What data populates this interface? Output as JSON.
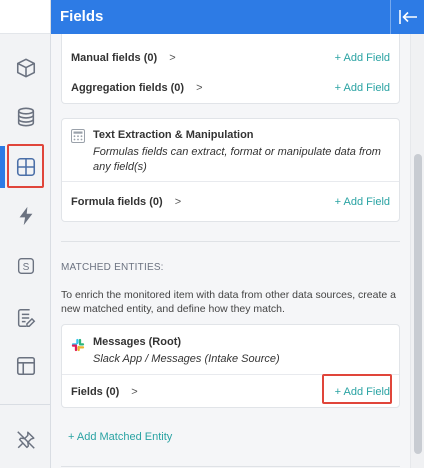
{
  "header": {
    "title": "Fields"
  },
  "rail": {
    "items": [
      {
        "id": "cube",
        "icon": "cube-icon"
      },
      {
        "id": "database",
        "icon": "database-icon"
      },
      {
        "id": "fields",
        "icon": "grid-icon",
        "active": true
      },
      {
        "id": "actions",
        "icon": "bolt-icon"
      },
      {
        "id": "scripts",
        "icon": "s-box-icon"
      },
      {
        "id": "notes",
        "icon": "note-edit-icon"
      },
      {
        "id": "layout",
        "icon": "layout-icon"
      },
      {
        "id": "unpin",
        "icon": "unpin-icon"
      }
    ]
  },
  "colors": {
    "header": "#2d7be5",
    "link": "#2aa3a3",
    "highlight": "#e0453a"
  },
  "basic_card": {
    "rows": [
      {
        "label": "Manual fields (0)",
        "chevron": ">",
        "action": "+ Add Field"
      },
      {
        "label": "Aggregation fields (0)",
        "chevron": ">",
        "action": "+ Add Field"
      }
    ]
  },
  "text_card": {
    "title": "Text Extraction & Manipulation",
    "subtitle": "Formulas fields can extract, format or manipulate data from any field(s)",
    "rows": [
      {
        "label": "Formula fields (0)",
        "chevron": ">",
        "action": "+ Add Field"
      }
    ]
  },
  "matched": {
    "label": "MATCHED ENTITIES:",
    "description": "To enrich the monitored item with data from other data sources, create a new matched entity, and define how they match.",
    "entity": {
      "title": "Messages (Root)",
      "subtitle": "Slack App / Messages (Intake Source)",
      "rows": [
        {
          "label": "Fields (0)",
          "chevron": ">",
          "action": "+ Add Field"
        }
      ]
    },
    "add_entity": "+ Add Matched Entity"
  }
}
